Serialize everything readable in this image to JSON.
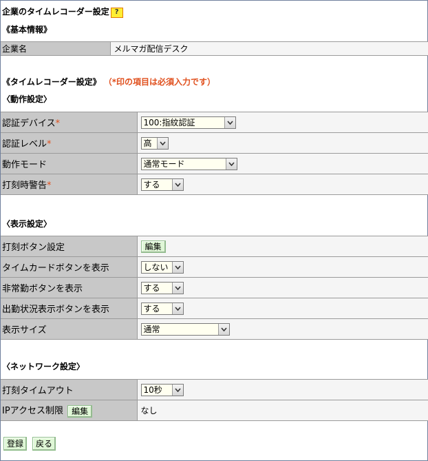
{
  "title": "企業のタイムレコーダー設定",
  "help_label": "?",
  "basic": {
    "heading": "《基本情報》",
    "company_label": "企業名",
    "company_value": "メルマガ配信デスク"
  },
  "timerecorder": {
    "heading": "《タイムレコーダー設定》",
    "required_note": "（*印の項目は必須入力です）"
  },
  "operation": {
    "heading": "〈動作設定〉",
    "rows": [
      {
        "label": "認証デバイス",
        "required": "*",
        "value": "100:指紋認証"
      },
      {
        "label": "認証レベル",
        "required": "*",
        "value": "高"
      },
      {
        "label": "動作モード",
        "required": "",
        "value": "通常モード"
      },
      {
        "label": "打刻時警告",
        "required": "*",
        "value": "する"
      }
    ]
  },
  "display": {
    "heading": "〈表示設定〉",
    "rows": [
      {
        "label": "打刻ボタン設定",
        "button": "編集"
      },
      {
        "label": "タイムカードボタンを表示",
        "value": "しない"
      },
      {
        "label": "非常勤ボタンを表示",
        "value": "する"
      },
      {
        "label": "出勤状況表示ボタンを表示",
        "value": "する"
      },
      {
        "label": "表示サイズ",
        "value": "通常"
      }
    ]
  },
  "network": {
    "heading": "〈ネットワーク設定〉",
    "rows": [
      {
        "label": "打刻タイムアウト",
        "value": "10秒"
      },
      {
        "label": "IPアクセス制限",
        "button": "編集",
        "value": "なし"
      }
    ]
  },
  "footer": {
    "register_label": "登録",
    "back_label": "戻る"
  }
}
